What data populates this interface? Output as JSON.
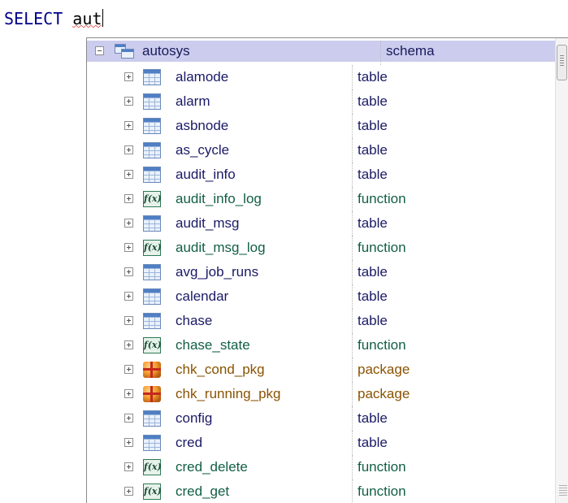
{
  "editor": {
    "keyword": "SELECT",
    "typed": "aut"
  },
  "completion": {
    "schema_row": {
      "name": "autosys",
      "type": "schema",
      "icon": "schema-icon"
    },
    "items": [
      {
        "name": "alamode",
        "type": "table",
        "icon": "table-icon"
      },
      {
        "name": "alarm",
        "type": "table",
        "icon": "table-icon"
      },
      {
        "name": "asbnode",
        "type": "table",
        "icon": "table-icon"
      },
      {
        "name": "as_cycle",
        "type": "table",
        "icon": "table-icon"
      },
      {
        "name": "audit_info",
        "type": "table",
        "icon": "table-icon"
      },
      {
        "name": "audit_info_log",
        "type": "function",
        "icon": "function-icon"
      },
      {
        "name": "audit_msg",
        "type": "table",
        "icon": "table-icon"
      },
      {
        "name": "audit_msg_log",
        "type": "function",
        "icon": "function-icon"
      },
      {
        "name": "avg_job_runs",
        "type": "table",
        "icon": "table-icon"
      },
      {
        "name": "calendar",
        "type": "table",
        "icon": "table-icon"
      },
      {
        "name": "chase",
        "type": "table",
        "icon": "table-icon"
      },
      {
        "name": "chase_state",
        "type": "function",
        "icon": "function-icon"
      },
      {
        "name": "chk_cond_pkg",
        "type": "package",
        "icon": "package-icon"
      },
      {
        "name": "chk_running_pkg",
        "type": "package",
        "icon": "package-icon"
      },
      {
        "name": "config",
        "type": "table",
        "icon": "table-icon"
      },
      {
        "name": "cred",
        "type": "table",
        "icon": "table-icon"
      },
      {
        "name": "cred_delete",
        "type": "function",
        "icon": "function-icon"
      },
      {
        "name": "cred_get",
        "type": "function",
        "icon": "function-icon"
      }
    ]
  },
  "colors": {
    "keyword": "#00008b",
    "schema_row_bg": "#ccccee",
    "table_text": "#1a1a66",
    "function_text": "#126044",
    "package_text": "#8a5200",
    "error_squiggle": "#e03a3a"
  }
}
